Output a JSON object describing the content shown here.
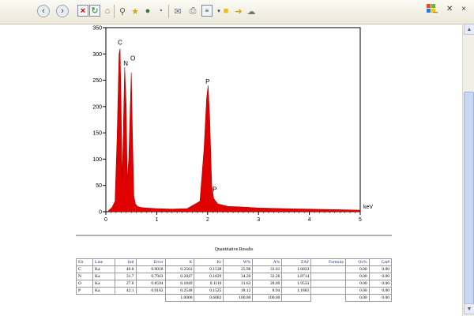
{
  "toolbar": {
    "buttons": [
      "back-icon",
      "forward-icon",
      "stop-icon",
      "refresh-icon",
      "home-icon",
      "search-icon",
      "favorites-icon",
      "media-icon",
      "history-icon",
      "mail-icon",
      "print-icon",
      "edit-icon",
      "discuss-icon",
      "messenger-icon"
    ],
    "window_controls": "_ ✕ ×"
  },
  "chart_data": {
    "type": "line",
    "title": "",
    "xlabel": "keV",
    "ylabel": "",
    "xlim": [
      0,
      5
    ],
    "ylim": [
      0,
      350
    ],
    "x_ticks": [
      0,
      1,
      2,
      3,
      4,
      5
    ],
    "y_ticks": [
      0,
      50,
      100,
      150,
      200,
      250,
      300,
      350
    ],
    "series": [
      {
        "x": [
          0.05,
          0.12,
          0.18,
          0.22,
          0.26,
          0.28,
          0.3,
          0.32,
          0.34,
          0.37,
          0.4,
          0.42,
          0.45,
          0.48,
          0.5,
          0.52,
          0.55,
          0.58,
          0.62,
          0.7,
          0.8,
          1.0,
          1.3,
          1.6,
          1.85,
          1.93,
          1.98,
          2.01,
          2.04,
          2.08,
          2.12,
          2.2,
          2.4,
          2.7,
          3.0,
          3.5,
          4.0,
          4.5,
          5.0
        ],
        "y": [
          2,
          8,
          20,
          140,
          300,
          310,
          200,
          60,
          140,
          275,
          200,
          60,
          100,
          200,
          265,
          160,
          30,
          15,
          10,
          8,
          7,
          6,
          5,
          6,
          20,
          120,
          215,
          240,
          180,
          50,
          25,
          15,
          10,
          9,
          7,
          6,
          5,
          4,
          3
        ]
      }
    ],
    "peak_labels": [
      {
        "label": "C",
        "x": 0.28,
        "y": 318
      },
      {
        "label": "N",
        "x": 0.39,
        "y": 278
      },
      {
        "label": "O",
        "x": 0.53,
        "y": 288
      },
      {
        "label": "P",
        "x": 2.0,
        "y": 243
      },
      {
        "label": "P",
        "x": 2.14,
        "y": 38
      }
    ]
  },
  "results": {
    "title": "Quantitative Results",
    "headers": [
      "Elt",
      "Line",
      "Intl",
      "Error",
      "K",
      "Kr",
      "W%",
      "A%",
      "ZAF",
      "Formula",
      "Ox%",
      "Cat#"
    ],
    "rows": [
      [
        "C",
        "Ka",
        "40.8",
        "0.9018",
        "0.2563",
        "0.1538",
        "25.96",
        "33.01",
        "1.6833",
        "",
        "0.00",
        "0.00"
      ],
      [
        "N",
        "Ka",
        "31.7",
        "0.7943",
        "0.2047",
        "0.1829",
        "34.26",
        "33.26",
        "1.8714",
        "",
        "0.00",
        "0.00"
      ],
      [
        "O",
        "Ka",
        "27.0",
        "0.8594",
        "0.1849",
        "0.1110",
        "31.63",
        "28.69",
        "1.9533",
        "",
        "0.00",
        "0.00"
      ],
      [
        "P",
        "Ka",
        "42.1",
        "0.9162",
        "0.2548",
        "0.1525",
        "18.12",
        "8.94",
        "1.1883",
        "",
        "0.00",
        "0.00"
      ]
    ],
    "totals": [
      "",
      "",
      "",
      "",
      "1.0000",
      "0.6082",
      "100.00",
      "100.00",
      "",
      "",
      "0.00",
      "0.00"
    ]
  }
}
